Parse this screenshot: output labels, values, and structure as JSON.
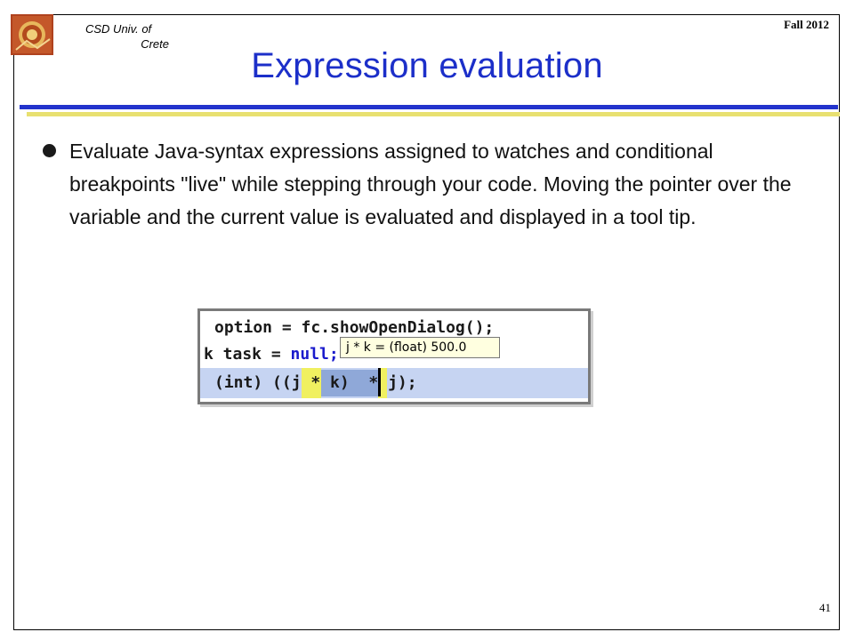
{
  "header": {
    "university_line1": "CSD Univ. of",
    "university_line2": "Crete",
    "term": "Fall 2012"
  },
  "slide": {
    "title": "Expression evaluation",
    "bullet": "Evaluate Java-syntax expressions assigned to watches and conditional breakpoints \"live\" while stepping through your code. Moving the pointer over the variable and the current value is evaluated and displayed in a tool tip.",
    "page_number": "41"
  },
  "code_snippet": {
    "line1": "option = fc.showOpenDialog();",
    "line2_prefix": "k task = ",
    "line2_keyword": "null;",
    "line3": "(int) ((j * k)  * j);",
    "tooltip": "j * k = (float) 500.0"
  },
  "colors": {
    "title": "#1c2fc9",
    "rule_blue": "#2233cc",
    "rule_yellow": "#e8e070"
  }
}
